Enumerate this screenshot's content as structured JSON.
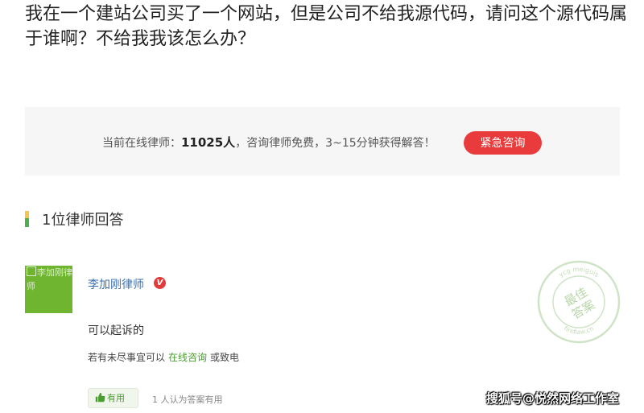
{
  "question": {
    "title": "我在一个建站公司买了一个网站，但是公司不给我源代码，请问这个源代码属于谁啊？不给我我该怎么办？"
  },
  "consult": {
    "text_before": "当前在线律师：",
    "online_count": "11025人",
    "text_after": "，咨询律师免费，3~15分钟获得解答！",
    "button_label": "紧急咨询",
    "button_color": "#e93b3b"
  },
  "answers_section": {
    "title": "1位律师回答"
  },
  "answer": {
    "avatar_alt": "李加刚律师",
    "lawyer_name": "李加刚律师",
    "verified_badge": "V",
    "text": "可以起诉的",
    "followup_before": "若有未尽事宜可以",
    "followup_link": "在线咨询",
    "followup_after": "或致电",
    "useful_label": "有用",
    "useful_count_text": "1 人认为答案有用",
    "stamp_main": "最佳答案",
    "stamp_ring_top": "findlaw.cn",
    "stamp_ring_bottom": "ycg meiguis"
  },
  "watermark": {
    "text": "搜狐号@悦然网络工作室"
  },
  "colors": {
    "accent_green": "#4a9d2f",
    "link_blue": "#3a6fb0",
    "avatar_green": "#6fb52f"
  }
}
